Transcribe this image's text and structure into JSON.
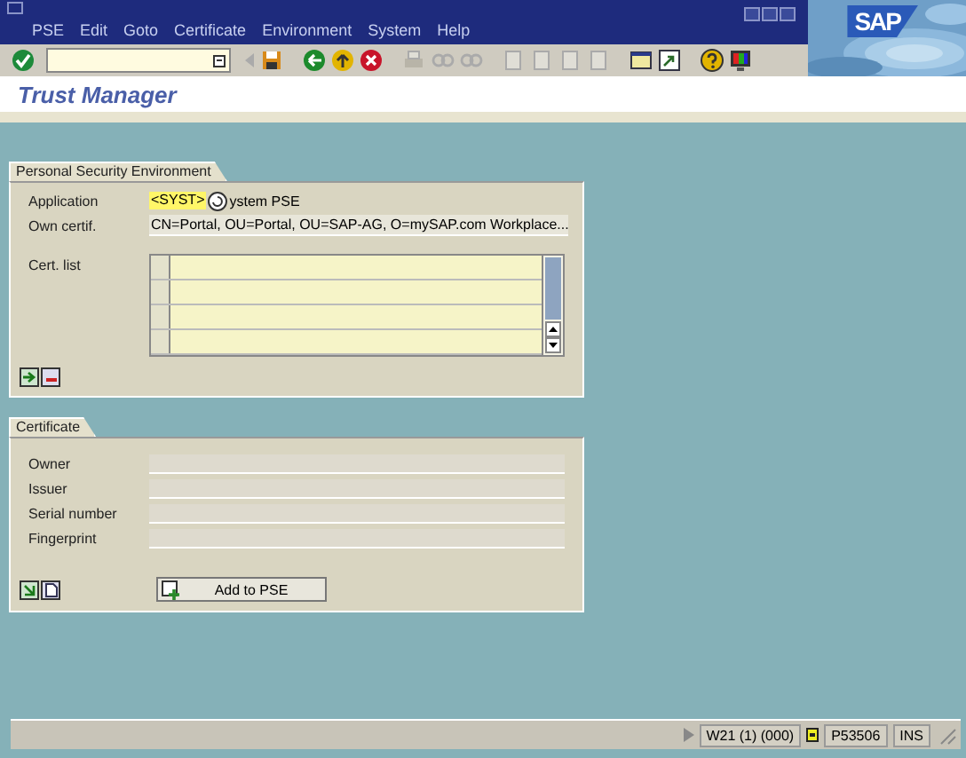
{
  "menu": [
    {
      "label": "PSE"
    },
    {
      "label": "Edit"
    },
    {
      "label": "Goto"
    },
    {
      "label": "Certificate"
    },
    {
      "label": "Environment"
    },
    {
      "label": "System"
    },
    {
      "label": "Help"
    }
  ],
  "logo": "SAP",
  "title": "Trust Manager",
  "pse_panel": {
    "title": "Personal Security Environment",
    "application": {
      "label": "Application",
      "value": "<SYST>",
      "button": "ystem PSE"
    },
    "own_certificate": {
      "label": "Own certif.",
      "value": "CN=Portal, OU=Portal, OU=SAP-AG, O=mySAP.com Workplace..."
    },
    "cert_list": {
      "label": "Cert. list"
    }
  },
  "certificate_panel": {
    "title": "Certificate",
    "fields": [
      {
        "label": "Owner"
      },
      {
        "label": "Issuer"
      },
      {
        "label": "Serial number"
      },
      {
        "label": "Fingerprint"
      }
    ],
    "button": "Add to PSE"
  },
  "status_bar": {
    "segments": [
      "W21 (1) (000)",
      "P53506",
      "INS"
    ]
  }
}
